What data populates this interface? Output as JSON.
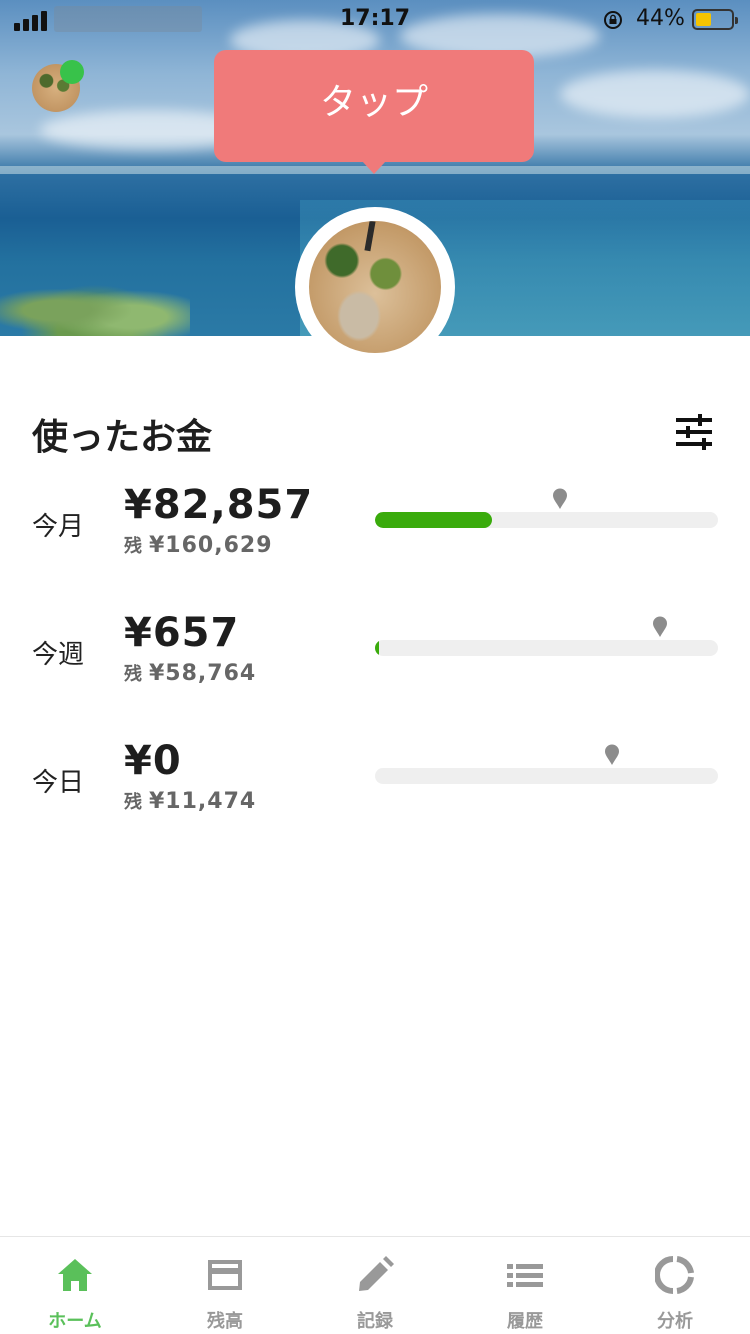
{
  "status_bar": {
    "time": "17:17",
    "battery_percent": "44%",
    "battery_level": 0.44,
    "icons": [
      "signal-icon",
      "rotation-lock-icon",
      "battery-icon"
    ]
  },
  "header": {
    "tooltip_text": "タップ",
    "online_status_color": "#38c24a"
  },
  "spending": {
    "title": "使ったお金",
    "remaining_label": "残",
    "rows": [
      {
        "period": "今月",
        "amount": "¥82,857",
        "remaining": "¥160,629",
        "progress": 0.34,
        "pin_position": 0.54
      },
      {
        "period": "今週",
        "amount": "¥657",
        "remaining": "¥58,764",
        "progress": 0.01,
        "pin_position": 0.83
      },
      {
        "period": "今日",
        "amount": "¥0",
        "remaining": "¥11,474",
        "progress": 0.0,
        "pin_position": 0.69
      }
    ],
    "bar_color": "#3aab0c"
  },
  "bottom_nav": {
    "items": [
      {
        "label": "ホーム",
        "icon": "home-icon",
        "active": true
      },
      {
        "label": "残高",
        "icon": "card-icon",
        "active": false
      },
      {
        "label": "記録",
        "icon": "pencil-icon",
        "active": false
      },
      {
        "label": "履歴",
        "icon": "list-icon",
        "active": false
      },
      {
        "label": "分析",
        "icon": "donut-chart-icon",
        "active": false
      }
    ],
    "active_color": "#5ac05a",
    "inactive_color": "#999999"
  }
}
